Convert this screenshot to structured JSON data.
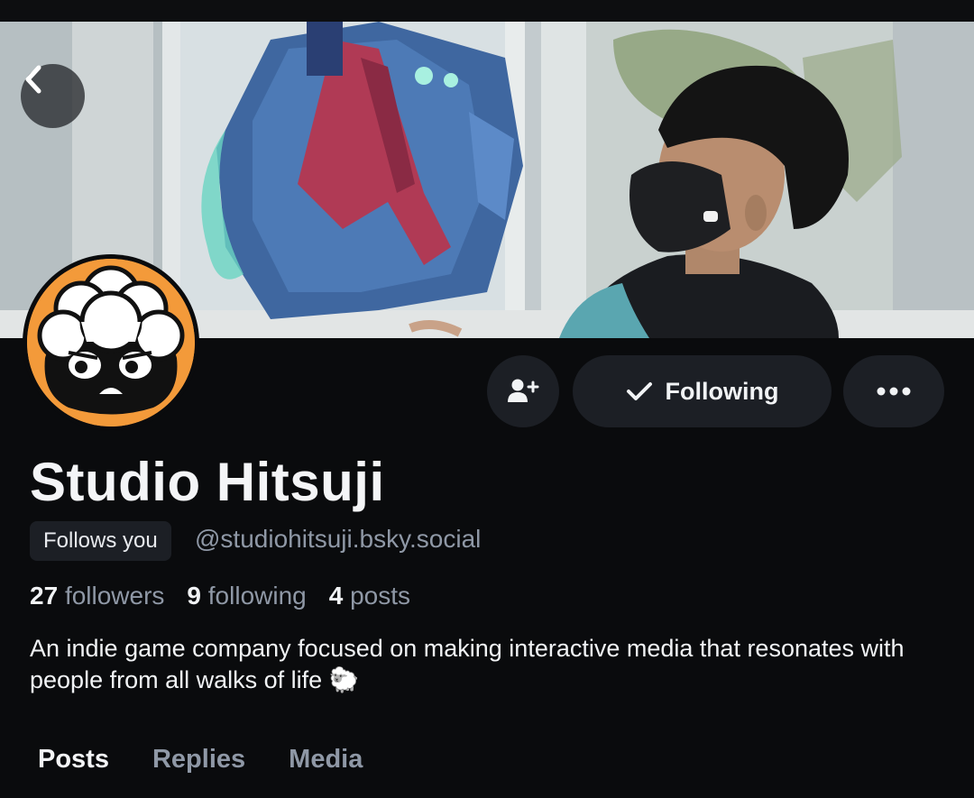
{
  "profile": {
    "display_name": "Studio Hitsuji",
    "follows_you_label": "Follows you",
    "handle": "@studiohitsuji.bsky.social",
    "bio": "An indie game company focused on making interactive media that resonates with people from all walks of life 🐑"
  },
  "stats": {
    "followers_count": "27",
    "followers_label": "followers",
    "following_count": "9",
    "following_label": "following",
    "posts_count": "4",
    "posts_label": "posts"
  },
  "actions": {
    "follow_label": "Following",
    "add_icon": "person-add-icon",
    "check_icon": "check-icon",
    "more_icon": "more-icon",
    "back_icon": "chevron-left-icon"
  },
  "tabs": [
    {
      "label": "Posts",
      "active": true
    },
    {
      "label": "Replies",
      "active": false
    },
    {
      "label": "Media",
      "active": false
    }
  ],
  "colors": {
    "background": "#0a0b0d",
    "button_bg": "#1c1f25",
    "muted_text": "#8f98a6",
    "avatar_orange": "#f39a3a"
  }
}
